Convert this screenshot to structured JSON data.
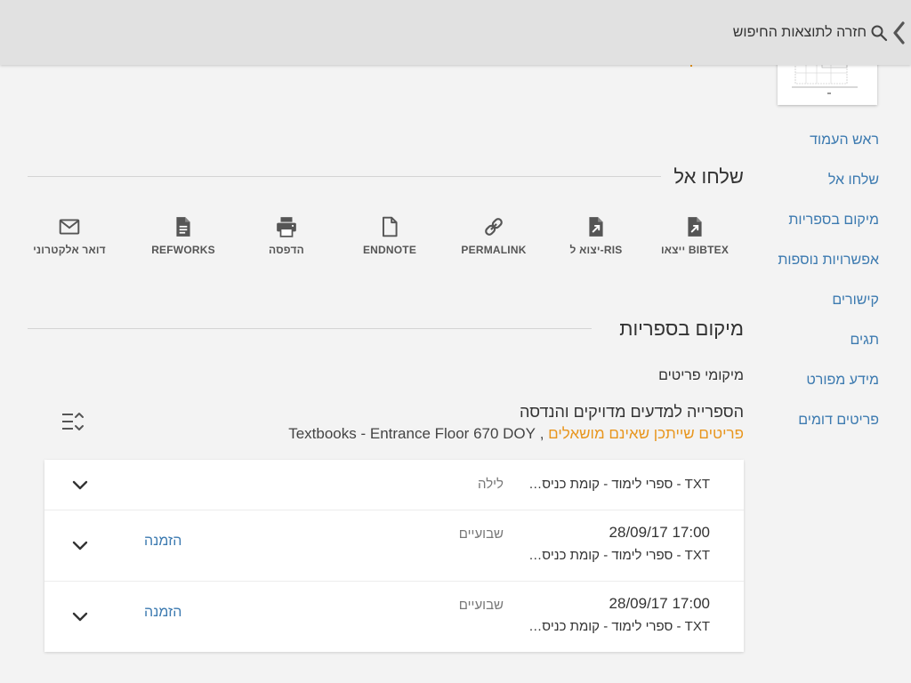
{
  "topbar": {
    "back_label": "חזרה לתוצאות החיפוש"
  },
  "sidenav": {
    "items": [
      {
        "label": "ראש העמוד"
      },
      {
        "label": "שלחו אל"
      },
      {
        "label": "מיקום בספריות"
      },
      {
        "label": "אפשרויות נוספות"
      },
      {
        "label": "קישורים"
      },
      {
        "label": "תגים"
      },
      {
        "label": "מידע מפורט"
      },
      {
        "label": "פריטים דומים"
      }
    ]
  },
  "send_to": {
    "title": "שלחו אל",
    "actions": [
      {
        "label": "ייצאו BIBTEX",
        "icon": "export-icon"
      },
      {
        "label": "יצוא ל-RIS",
        "icon": "export-icon"
      },
      {
        "label": "PERMALINK",
        "icon": "link-icon"
      },
      {
        "label": "ENDNOTE",
        "icon": "file-icon"
      },
      {
        "label": "הדפסה",
        "icon": "print-icon"
      },
      {
        "label": "REFWORKS",
        "icon": "document-icon"
      },
      {
        "label": "דואר אלקטרוני",
        "icon": "email-icon"
      }
    ]
  },
  "location": {
    "title": "מיקום בספריות",
    "sub_label": "מיקומי פריטים",
    "library_name": "הספרייה למדעים מדויקים והנדסה",
    "status": "פריטים שייתכן שאינם מושאלים",
    "separator": " , ",
    "shelf": "Textbooks - Entrance Floor 670 DOY",
    "items": [
      {
        "due": "",
        "location": "TXT - ספרי לימוד - קומת כניס…",
        "policy": "לילה",
        "request": ""
      },
      {
        "due": "28/09/17 17:00",
        "location": "TXT - ספרי לימוד - קומת כניס…",
        "policy": "שבועיים",
        "request": "הזמנה"
      },
      {
        "due": "28/09/17 17:00",
        "location": "TXT - ספרי לימוד - קומת כניס…",
        "policy": "שבועיים",
        "request": "הזמנה"
      }
    ]
  },
  "colors": {
    "accent_link": "#3c7ab0",
    "status_orange": "#e8961e",
    "topbar": "#e1e1e1",
    "background": "#f3f3f3"
  }
}
